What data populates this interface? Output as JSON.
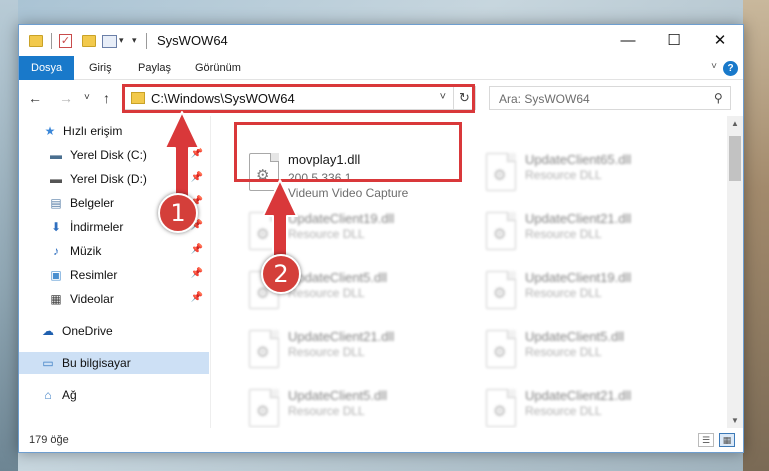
{
  "window": {
    "title": "SysWOW64",
    "minimize_glyph": "—",
    "maximize_glyph": "☐",
    "close_glyph": "✕"
  },
  "quick_access_toolbar": {
    "check_glyph": "✓",
    "dropdown_glyph": "▾"
  },
  "ribbon": {
    "tabs": [
      "Dosya",
      "Giriş",
      "Paylaş",
      "Görünüm"
    ],
    "active_tab": "Dosya",
    "active_color": "#1979ca",
    "expand_glyph": "˅",
    "help_glyph": "?"
  },
  "address_bar": {
    "back_glyph": "←",
    "forward_glyph": "→",
    "recent_glyph": "˅",
    "up_glyph": "↑",
    "path": "C:\\Windows\\SysWOW64",
    "dropdown_glyph": "˅",
    "refresh_glyph": "↻"
  },
  "search": {
    "placeholder": "Ara: SysWOW64",
    "icon_glyph": "⚲"
  },
  "nav_pane": {
    "items": [
      {
        "label": "Hızlı erişim",
        "icon": "star-icon",
        "glyph": "★",
        "color": "#3a86d8"
      },
      {
        "label": "Yerel Disk (C:)",
        "icon": "drive-icon",
        "glyph": "▬",
        "color": "#4a6f8f",
        "pin": "📌"
      },
      {
        "label": "Yerel Disk (D:)",
        "icon": "drive-icon",
        "glyph": "▬",
        "color": "#555555",
        "pin": "📌"
      },
      {
        "label": "Belgeler",
        "icon": "documents-icon",
        "glyph": "▤",
        "color": "#5a7fa8",
        "pin": "📌"
      },
      {
        "label": "İndirmeler",
        "icon": "download-icon",
        "glyph": "⬇",
        "color": "#2f6fbf",
        "pin": "📌"
      },
      {
        "label": "Müzik",
        "icon": "music-icon",
        "glyph": "♪",
        "color": "#2f6fbf",
        "pin": "📌"
      },
      {
        "label": "Resimler",
        "icon": "pictures-icon",
        "glyph": "▣",
        "color": "#4a8fcf",
        "pin": "📌"
      },
      {
        "label": "Videolar",
        "icon": "video-icon",
        "glyph": "▦",
        "color": "#444444",
        "pin": "📌"
      },
      {
        "label": "OneDrive",
        "icon": "cloud-icon",
        "glyph": "☁",
        "color": "#1f5fae"
      },
      {
        "label": "Bu bilgisayar",
        "icon": "computer-icon",
        "glyph": "▭",
        "color": "#3b7dc4",
        "selected": true
      },
      {
        "label": "Ağ",
        "icon": "network-icon",
        "glyph": "⌂",
        "color": "#3b7dc4"
      }
    ]
  },
  "files": [
    {
      "name": "movplay1.dll",
      "line1": "200.5.336.1",
      "line2": "Videum Video Capture",
      "highlighted": true
    },
    {
      "name": "UpdateClient65.dll",
      "line1": "Resource DLL",
      "blurred": true
    },
    {
      "name": "UpdateClient19.dll",
      "line1": "Resource DLL",
      "blurred": true
    },
    {
      "name": "UpdateClient21.dll",
      "line1": "Resource DLL",
      "blurred": true
    },
    {
      "name": "UpdateClient5.dll",
      "line1": "Resource DLL",
      "blurred": true
    },
    {
      "name": "UpdateClient19.dll",
      "line1": "Resource DLL",
      "blurred": true
    },
    {
      "name": "UpdateClient21.dll",
      "line1": "Resource DLL",
      "blurred": true
    },
    {
      "name": "UpdateClient5.dll",
      "line1": "Resource DLL",
      "blurred": true
    },
    {
      "name": "UpdateClient5.dll",
      "line1": "Resource DLL",
      "blurred": true
    },
    {
      "name": "UpdateClient21.dll",
      "line1": "Resource DLL",
      "blurred": true
    }
  ],
  "scrollbar": {
    "up_glyph": "▲",
    "down_glyph": "▼"
  },
  "status_bar": {
    "item_count": "179 öğe",
    "details_glyph": "☰",
    "tiles_glyph": "▦"
  },
  "annotations": {
    "color": "#d9383a",
    "badges": [
      "1",
      "2"
    ]
  }
}
